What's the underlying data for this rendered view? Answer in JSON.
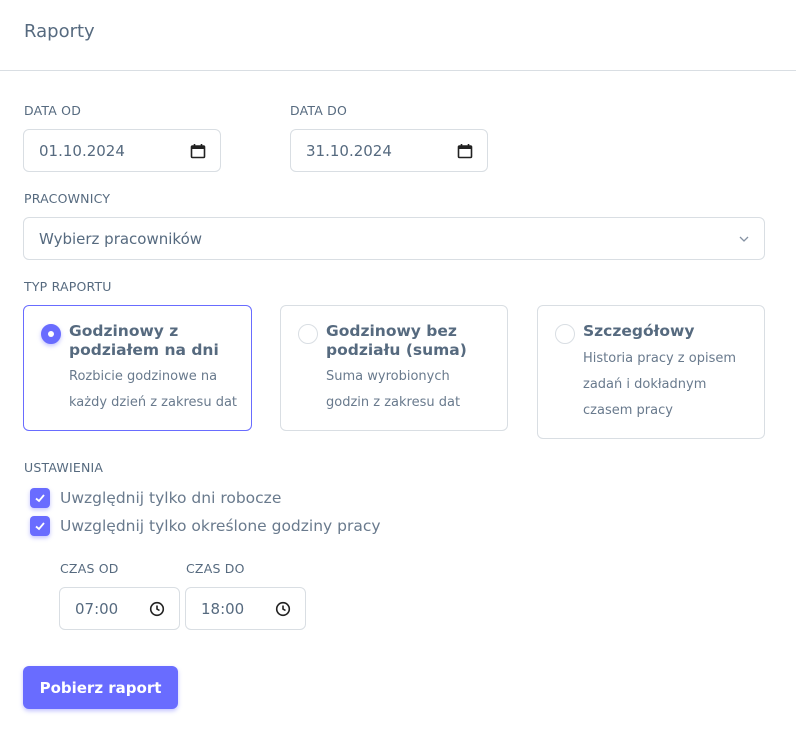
{
  "header": {
    "title": "Raporty"
  },
  "form": {
    "date_from": {
      "label": "DATA OD",
      "value": "01.10.2024"
    },
    "date_to": {
      "label": "DATA DO",
      "value": "31.10.2024"
    },
    "employees": {
      "label": "PRACOWNICY",
      "placeholder": "Wybierz pracowników"
    },
    "report_type": {
      "label": "TYP RAPORTU",
      "options": [
        {
          "title": "Godzinowy z podziałem na dni",
          "description": "Rozbicie godzinowe na każdy dzień z zakresu dat",
          "checked": true
        },
        {
          "title": "Godzinowy bez podziału (suma)",
          "description": "Suma wyrobionych godzin z zakresu dat",
          "checked": false
        },
        {
          "title": "Szczegółowy",
          "description": "Historia pracy z opisem zadań i dokładnym czasem pracy",
          "checked": false
        }
      ]
    },
    "settings": {
      "label": "USTAWIENIA",
      "checkboxes": [
        {
          "label": "Uwzględnij tylko dni robocze",
          "checked": true
        },
        {
          "label": "Uwzględnij tylko określone godziny pracy",
          "checked": true
        }
      ],
      "time_from": {
        "label": "CZAS OD",
        "value": "07:00"
      },
      "time_to": {
        "label": "CZAS DO",
        "value": "18:00"
      }
    },
    "submit": {
      "label": "Pobierz raport"
    }
  },
  "colors": {
    "primary": "#696cff",
    "border": "#d9dee3",
    "text": "#566a7f"
  },
  "icons": {
    "date": "calendar-icon",
    "time": "clock-icon",
    "select": "chevron-down-icon",
    "checkbox": "check-icon"
  }
}
